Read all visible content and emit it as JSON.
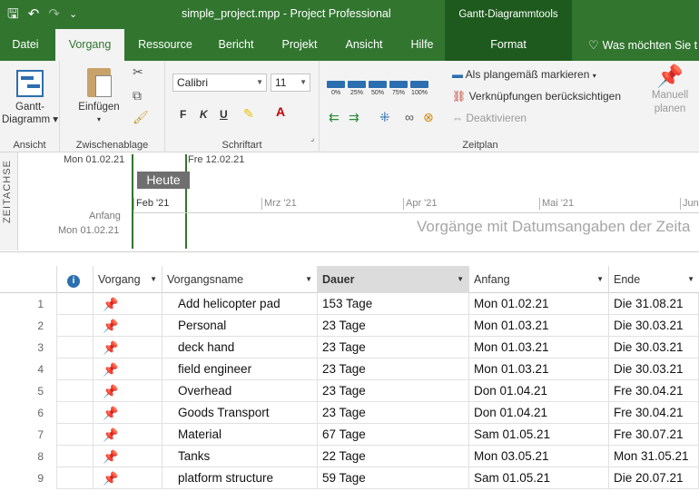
{
  "window": {
    "title": "simple_project.mpp  -  Project Professional",
    "context_tool": "Gantt-Diagrammtools"
  },
  "tabs": [
    {
      "label": "Datei"
    },
    {
      "label": "Vorgang"
    },
    {
      "label": "Ressource"
    },
    {
      "label": "Bericht"
    },
    {
      "label": "Projekt"
    },
    {
      "label": "Ansicht"
    },
    {
      "label": "Hilfe"
    },
    {
      "label": "Format"
    }
  ],
  "tellme": "Was möchten Sie t",
  "ribbon": {
    "ansicht": {
      "button": "Gantt-",
      "button2": "Diagramm ▾",
      "group": "Ansicht"
    },
    "clipboard": {
      "paste": "Einfügen",
      "group": "Zwischenablage"
    },
    "font": {
      "name": "Calibri",
      "size": "11",
      "bold": "F",
      "italic": "K",
      "underline": "U",
      "group": "Schriftart"
    },
    "zeitplan": {
      "pct": [
        "0%",
        "25%",
        "50%",
        "75%",
        "100%"
      ],
      "mark_on_track": "Als plangemäß markieren",
      "respect_links": "Verknüpfungen berücksichtigen",
      "deactivate": "Deaktivieren",
      "group": "Zeitplan"
    },
    "manual": {
      "line1": "Manuell",
      "line2": "planen"
    }
  },
  "timeline": {
    "side_label": "ZEITACHSE",
    "start_top": "Mon 01.02.21",
    "today_date": "Fre 12.02.21",
    "today_label": "Heute",
    "anfang_label": "Anfang",
    "anfang_date": "Mon 01.02.21",
    "months": [
      "Feb '21",
      "Mrz '21",
      "Apr '21",
      "Mai '21",
      "Jun"
    ],
    "hint": "Vorgänge mit Datumsangaben der Zeita"
  },
  "table": {
    "headers": {
      "info": "i",
      "mode": "Vorgang",
      "name": "Vorgangsname",
      "duration": "Dauer",
      "start": "Anfang",
      "finish": "Ende"
    },
    "rows": [
      {
        "id": "1",
        "name": "Add helicopter pad",
        "duration": "153 Tage",
        "start": "Mon 01.02.21",
        "finish": "Die 31.08.21"
      },
      {
        "id": "2",
        "name": "Personal",
        "duration": "23 Tage",
        "start": "Mon 01.03.21",
        "finish": "Die 30.03.21"
      },
      {
        "id": "3",
        "name": "deck hand",
        "duration": "23 Tage",
        "start": "Mon 01.03.21",
        "finish": "Die 30.03.21"
      },
      {
        "id": "4",
        "name": "field engineer",
        "duration": "23 Tage",
        "start": "Mon 01.03.21",
        "finish": "Die 30.03.21"
      },
      {
        "id": "5",
        "name": "Overhead",
        "duration": "23 Tage",
        "start": "Don 01.04.21",
        "finish": "Fre 30.04.21"
      },
      {
        "id": "6",
        "name": "Goods Transport",
        "duration": "23 Tage",
        "start": "Don 01.04.21",
        "finish": "Fre 30.04.21"
      },
      {
        "id": "7",
        "name": "Material",
        "duration": "67 Tage",
        "start": "Sam 01.05.21",
        "finish": "Fre 30.07.21"
      },
      {
        "id": "8",
        "name": "Tanks",
        "duration": "22 Tage",
        "start": "Mon 03.05.21",
        "finish": "Mon 31.05.21"
      },
      {
        "id": "9",
        "name": "platform structure",
        "duration": "59 Tage",
        "start": "Sam 01.05.21",
        "finish": "Die 20.07.21"
      }
    ]
  }
}
